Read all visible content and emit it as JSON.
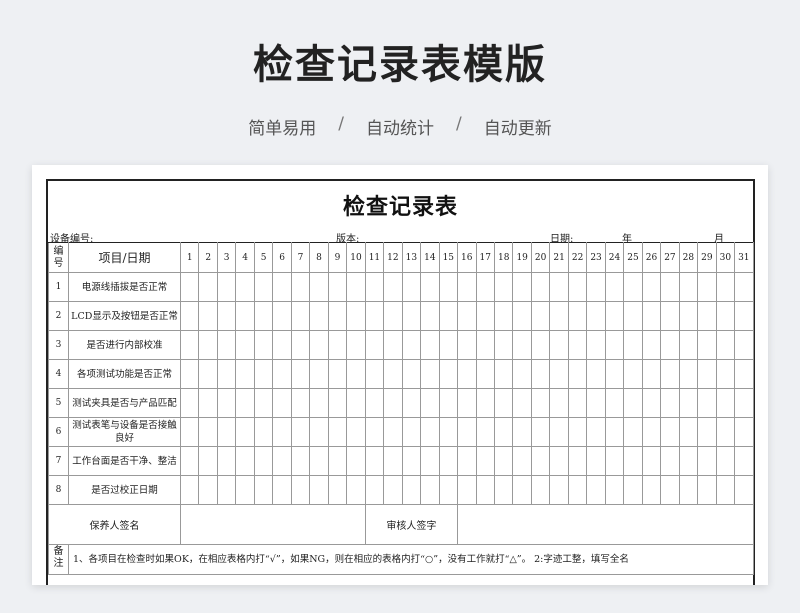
{
  "header": {
    "title": "检查记录表模版",
    "tags": [
      "简单易用",
      "自动统计",
      "自动更新"
    ],
    "separator": "/"
  },
  "sheet": {
    "title": "检查记录表",
    "meta": {
      "device_label": "设备编号:",
      "version_label": "版本:",
      "date_label": "日期:",
      "year_label": "年",
      "month_label": "月"
    },
    "columns": {
      "no": "编号",
      "item": "项目/日期",
      "days": [
        "1",
        "2",
        "3",
        "4",
        "5",
        "6",
        "7",
        "8",
        "9",
        "10",
        "11",
        "12",
        "13",
        "14",
        "15",
        "16",
        "17",
        "18",
        "19",
        "20",
        "21",
        "22",
        "23",
        "24",
        "25",
        "26",
        "27",
        "28",
        "29",
        "30",
        "31"
      ]
    },
    "rows": [
      {
        "no": "1",
        "item": "电源线插拔是否正常"
      },
      {
        "no": "2",
        "item": "LCD显示及按钮是否正常"
      },
      {
        "no": "3",
        "item": "是否进行内部校准"
      },
      {
        "no": "4",
        "item": "各项测试功能是否正常"
      },
      {
        "no": "5",
        "item": "测试夹具是否与产品匹配"
      },
      {
        "no": "6",
        "item": "测试表笔与设备是否接触良好"
      },
      {
        "no": "7",
        "item": "工作台面是否干净、整洁"
      },
      {
        "no": "8",
        "item": "是否过校正日期"
      }
    ],
    "signatures": {
      "maintainer": "保养人签名",
      "reviewer": "审核人签字"
    },
    "note": {
      "label": "备注",
      "text": "1、各项目在检查时如果OK，在相应表格内打“√”，如果NG，则在相应的表格内打“○”，没有工作就打“△”。    2:字迹工整，填写全名"
    }
  }
}
